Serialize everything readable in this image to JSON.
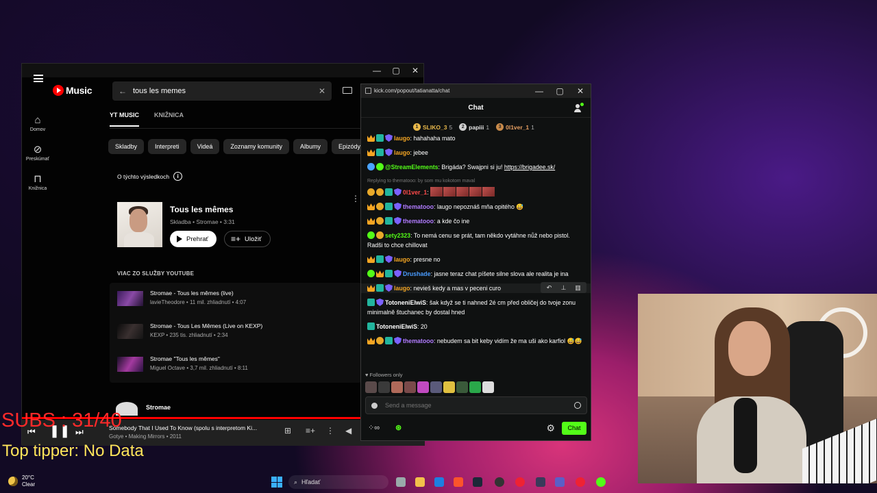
{
  "ytmusic": {
    "logo_text": "Music",
    "nav": [
      {
        "label": "Domov",
        "icon": "home-icon"
      },
      {
        "label": "Preskúmať",
        "icon": "explore-icon"
      },
      {
        "label": "Knižnica",
        "icon": "library-icon"
      }
    ],
    "search_value": "tous les memes",
    "tabs": [
      "YT MUSIC",
      "KNIŽNICA"
    ],
    "chips": [
      "Skladby",
      "Interpreti",
      "Videá",
      "Zoznamy komunity",
      "Albumy",
      "Epizódy"
    ],
    "about_results": "O týchto výsledkoch",
    "top_result": {
      "title": "Tous les mêmes",
      "subtitle": "Skladba • Stromae • 3:31",
      "play_label": "Prehrať",
      "save_label": "Uložiť"
    },
    "more_from_youtube": "VIAC ZO SLUŽBY YOUTUBE",
    "videos": [
      {
        "title": "Stromae - Tous les mêmes (live)",
        "sub": "lavieTheodore • 11 mil. zhliadnutí • 4:07"
      },
      {
        "title": "Stromae - Tous Les Mêmes (Live on KEXP)",
        "sub": "KEXP • 235 tis. zhliadnutí • 2:34"
      },
      {
        "title": "Stromae \"Tous les mêmes\"",
        "sub": "Miguel Octave • 3,7 mil. zhliadnutí • 8:11"
      }
    ],
    "artist_name": "Stromae",
    "now_playing": {
      "title": "Somebody That I Used To Know (spolu s interpretom Ki...",
      "sub": "Gotye • Making Mirrors • 2011"
    }
  },
  "chat": {
    "url": "kick.com/popout/tatianatta/chat",
    "title": "Chat",
    "leaderboard": [
      {
        "rank": "1",
        "name": "SLIKO_3",
        "count": "5",
        "color": "#e8b84a"
      },
      {
        "rank": "2",
        "name": "papiii",
        "count": "1",
        "color": "#cfcfcf"
      },
      {
        "rank": "3",
        "name": "0l1ver_1",
        "count": "1",
        "color": "#c98a4a"
      }
    ],
    "messages": [
      {
        "user": "laugo",
        "color": "#f5a623",
        "text": "hahahaha mato",
        "badges": [
          "crown",
          "gift",
          "shield"
        ]
      },
      {
        "user": "laugo",
        "color": "#f5a623",
        "text": "jebee",
        "badges": [
          "crown",
          "gift",
          "shield"
        ]
      },
      {
        "user": "@StreamElements",
        "color": "#53fc18",
        "text": "Brigáda? Swajpni si ju!",
        "link": "https://brigadee.sk/",
        "badges": [
          "bot",
          "green"
        ]
      },
      {
        "reply": "Replying to thematooo: by som mu kokotom maval",
        "user": "0l1ver_1",
        "color": "#ff4a4a",
        "text": "",
        "badges": [
          "coin",
          "coin",
          "gift",
          "shield"
        ],
        "emotes": 5
      },
      {
        "user": "thematooo",
        "color": "#b17cff",
        "text": "laugo nepoznáš mňa opitého 😅",
        "badges": [
          "crown",
          "coin",
          "gift",
          "shield"
        ]
      },
      {
        "user": "thematooo",
        "color": "#b17cff",
        "text": "a kde čo ine",
        "badges": [
          "crown",
          "coin",
          "gift",
          "shield"
        ]
      },
      {
        "user": "sety2323",
        "color": "#53fc18",
        "text": "To nemá cenu se prát, tam někdo vytáhne nůž nebo pistol. Radši to chce chillovat",
        "badges": [
          "green",
          "coin"
        ]
      },
      {
        "user": "laugo",
        "color": "#f5a623",
        "text": "presne no",
        "badges": [
          "crown",
          "gift",
          "shield"
        ]
      },
      {
        "user": "Drushade",
        "color": "#4a9cff",
        "text": "jasne teraz chat píšete silne slova ale realita je ina",
        "badges": [
          "green",
          "crown",
          "gift",
          "shield"
        ]
      },
      {
        "user": "laugo",
        "color": "#f5a623",
        "text": "nevieš kedy a mas v peceni curo",
        "badges": [
          "crown",
          "gift",
          "shield"
        ],
        "hover": true
      },
      {
        "user": "TotoneniElwiS",
        "color": "#ffffff",
        "text": "šak když se ti nahned 2é cm před obličej do tvoje zonu minimalně štuchanec by dostal hned",
        "badges": [
          "gift",
          "shield"
        ]
      },
      {
        "user": "TotoneniElwiS",
        "color": "#ffffff",
        "text": "20",
        "badges": [
          "gift"
        ]
      },
      {
        "user": "thematooo",
        "color": "#b17cff",
        "text": "nebudem sa bit keby vidím že ma uši ako karfiol 😅😅",
        "badges": [
          "crown",
          "coin",
          "gift",
          "shield"
        ]
      }
    ],
    "followers_only": "Followers only",
    "send_placeholder": "Send a message",
    "chat_button": "Chat"
  },
  "overlay": {
    "subs": "SUBS : 31/40",
    "top_tipper": "Top tipper: No Data"
  },
  "taskbar": {
    "temp": "20°C",
    "condition": "Clear",
    "search": "Hľadať"
  },
  "colors": {
    "kick_green": "#53fc18",
    "yt_red": "#ff0000"
  }
}
